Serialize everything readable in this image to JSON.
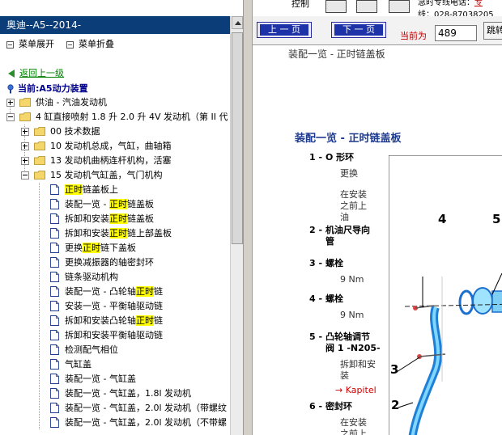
{
  "left": {
    "title": "奥迪--A5--2014-",
    "menu": {
      "expand": "菜单展开",
      "collapse": "菜单折叠"
    },
    "back": "返回上一级",
    "current": "当前:A5动力装置",
    "tree": [
      {
        "text": "供油 - 汽油发动机",
        "kind": "folder",
        "pm": "plus"
      },
      {
        "text": "4 缸直接喷射 1.8 升 2.0 升 4V 发动机（第 II 代",
        "kind": "folder",
        "pm": "minus"
      },
      {
        "text": "00 技术数据",
        "kind": "folder",
        "pm": "plus"
      },
      {
        "text": "10 发动机总成，气缸，曲轴箱",
        "kind": "folder",
        "pm": "plus"
      },
      {
        "text": "13 发动机曲柄连杆机构，活塞",
        "kind": "folder",
        "pm": "plus"
      },
      {
        "text": "15 发动机气缸盖，气门机构",
        "kind": "folder",
        "pm": "minus"
      },
      {
        "pre": "",
        "hl": "正时",
        "post": "链盖板上",
        "kind": "doc",
        "selected": true
      },
      {
        "pre": "装配一览 - ",
        "hl": "正时",
        "post": "链盖板",
        "kind": "doc"
      },
      {
        "pre": "拆卸和安装",
        "hl": "正时",
        "post": "链盖板",
        "kind": "doc"
      },
      {
        "pre": "拆卸和安装",
        "hl": "正时",
        "post": "链上部盖板",
        "kind": "doc"
      },
      {
        "pre": "更换",
        "hl": "正时",
        "post": "链下盖板",
        "kind": "doc"
      },
      {
        "pre": "更换减振器的轴密封环",
        "hl": "",
        "post": "",
        "kind": "doc"
      },
      {
        "pre": "链条驱动机构",
        "hl": "",
        "post": "",
        "kind": "doc"
      },
      {
        "pre": "装配一览 - 凸轮轴",
        "hl": "正时",
        "post": "链",
        "kind": "doc"
      },
      {
        "pre": "安装一览 - 平衡轴驱动链",
        "hl": "",
        "post": "",
        "kind": "doc"
      },
      {
        "pre": "拆卸和安装凸轮轴",
        "hl": "正时",
        "post": "链",
        "kind": "doc"
      },
      {
        "pre": "拆卸和安装平衡轴驱动链",
        "hl": "",
        "post": "",
        "kind": "doc"
      },
      {
        "pre": "检测配气相位",
        "hl": "",
        "post": "",
        "kind": "doc"
      },
      {
        "pre": "气缸盖",
        "hl": "",
        "post": "",
        "kind": "doc"
      },
      {
        "pre": "装配一览 - 气缸盖",
        "hl": "",
        "post": "",
        "kind": "doc"
      },
      {
        "pre": "装配一览 - 气缸盖，1.8l 发动机",
        "hl": "",
        "post": "",
        "kind": "doc"
      },
      {
        "pre": "装配一览 - 气缸盖，2.0l 发动机（带螺纹",
        "hl": "",
        "post": "",
        "kind": "doc"
      },
      {
        "pre": "装配一览 - 气缸盖，2.0l 发动机（不带螺",
        "hl": "",
        "post": "",
        "kind": "doc"
      }
    ]
  },
  "right": {
    "toolbar": {
      "control": "控制",
      "contact_pre": "急时专线电话：",
      "contact_red": "专",
      "contact_line2": "线：028-87038205"
    },
    "nav": {
      "prev": "上 一 页",
      "next": "下 一 页",
      "current_label": "当前为",
      "page": "489",
      "jump": "跳转"
    },
    "breadcrumb": "装配一览 - 正时链盖板",
    "heading": "装配一览 - 正时链盖板",
    "parts": [
      {
        "num": "1 -",
        "title": [
          "O 形环"
        ],
        "bullets": [
          [
            "更换"
          ],
          [
            "在安装",
            "之前上",
            "油"
          ]
        ]
      },
      {
        "num": "2 -",
        "title": [
          "机油尺导向",
          "管"
        ],
        "bullets": []
      },
      {
        "num": "3 -",
        "title": [
          "螺栓"
        ],
        "bullets": [
          [
            "9 Nm"
          ]
        ]
      },
      {
        "num": "4 -",
        "title": [
          "螺栓"
        ],
        "bullets": [
          [
            "9 Nm"
          ]
        ]
      },
      {
        "num": "5 -",
        "title": [
          "凸轮轴调节",
          "阀 1 -N205-"
        ],
        "bullets": [
          [
            "拆卸和安",
            "装"
          ]
        ],
        "link": "→ Kapitel"
      },
      {
        "num": "6 -",
        "title": [
          "密封环"
        ],
        "bullets": [
          [
            "在安装",
            "之前上"
          ]
        ]
      }
    ],
    "callouts": [
      "4",
      "5",
      "3",
      "2"
    ]
  }
}
